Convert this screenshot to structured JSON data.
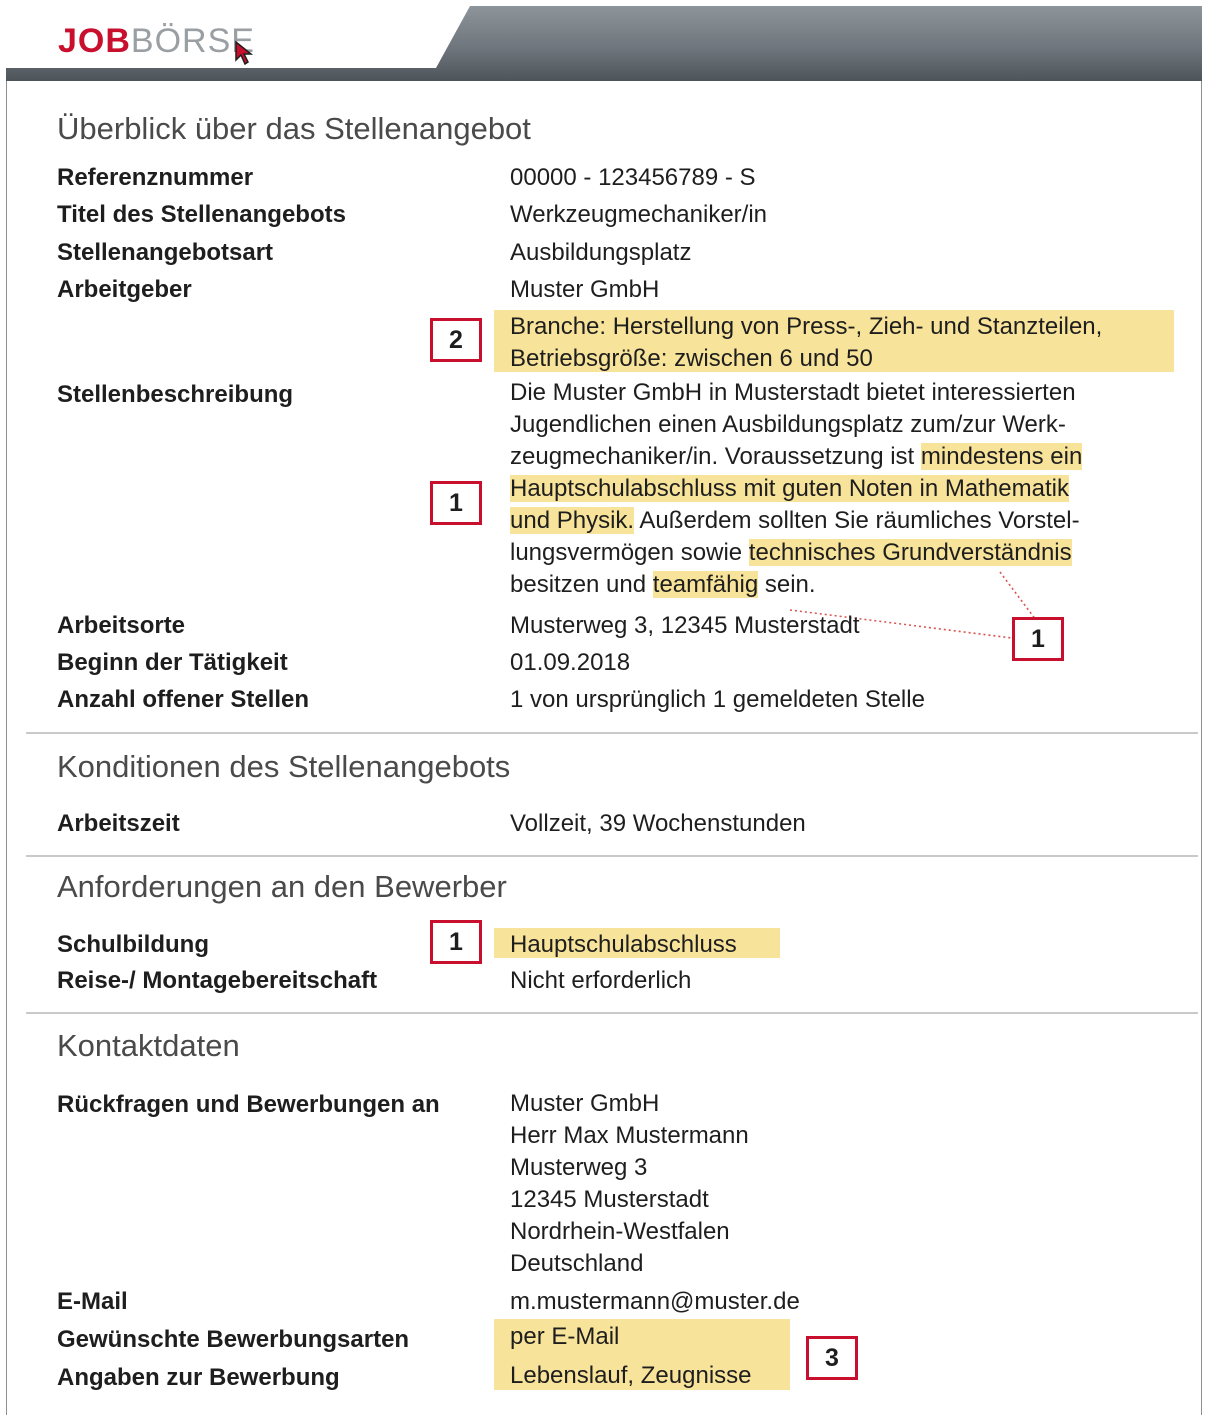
{
  "brand": {
    "job": "JOB",
    "boerse": "BÖRSE"
  },
  "colors": {
    "accent": "#c8102e",
    "highlight": "#f8e39a",
    "header": "#6f767d"
  },
  "overview": {
    "title": "Überblick über das Stellenangebot",
    "rows": [
      {
        "label": "Referenznummer",
        "value": "00000 - 123456789 - S"
      },
      {
        "label": "Titel des Stellenangebots",
        "value": "Werkzeugmechaniker/in"
      },
      {
        "label": "Stellenangebotsart",
        "value": "Ausbildungsplatz"
      },
      {
        "label": "Arbeitgeber",
        "value": "Muster GmbH"
      }
    ],
    "employer_details": [
      "Branche: Herstellung von Press-, Zieh- und Stanzteilen,",
      "Betriebsgröße: zwischen 6 und 50"
    ],
    "description": {
      "label": "Stellenbeschreibung",
      "line1": "Die Muster GmbH in Musterstadt bietet interessierten",
      "line2": "Jugendlichen einen Ausbildungsplatz zum/zur Werk-",
      "line3_a": "zeugmechaniker/in. Voraussetzung ist ",
      "line3_b": "mindestens ein",
      "line4": "Hauptschulabschluss mit guten Noten in Mathematik",
      "line5_a": "und Physik.",
      "line5_b": " Außerdem sollten Sie räumliches Vorstel-",
      "line6_a": "lungsvermögen sowie ",
      "line6_b": "technisches Grundverständnis",
      "line7_a": "besitzen und ",
      "line7_b": "teamfähig",
      "line7_c": " sein."
    },
    "rows2": [
      {
        "label": "Arbeitsorte",
        "value": "Musterweg 3, 12345 Musterstadt"
      },
      {
        "label": "Beginn der Tätigkeit",
        "value": "01.09.2018"
      },
      {
        "label": "Anzahl offener Stellen",
        "value": "1 von ursprünglich 1 gemeldeten Stelle"
      }
    ]
  },
  "conditions": {
    "title": "Konditionen des Stellenangebots",
    "label": "Arbeitszeit",
    "value": "Vollzeit, 39 Wochenstunden"
  },
  "requirements": {
    "title": "Anforderungen an den Bewerber",
    "rows": [
      {
        "label": "Schulbildung",
        "value": "Hauptschulabschluss"
      },
      {
        "label": "Reise-/ Montagebereitschaft",
        "value": "Nicht erforderlich"
      }
    ]
  },
  "contact": {
    "title": "Kontaktdaten",
    "label": "Rückfragen und Bewerbungen an",
    "address": [
      "Muster GmbH",
      "Herr Max Mustermann",
      "Musterweg 3",
      "12345 Musterstadt",
      "Nordrhein-Westfalen",
      "Deutschland"
    ],
    "email_label": "E-Mail",
    "email": "m.mustermann@muster.de",
    "application_types_label": "Gewünschte Bewerbungsarten",
    "application_types": "per E-Mail",
    "application_info_label": "Angaben zur Bewerbung",
    "application_info": "Lebenslauf, Zeugnisse"
  },
  "markers": {
    "m1": "1",
    "m2": "2",
    "m3": "3"
  }
}
